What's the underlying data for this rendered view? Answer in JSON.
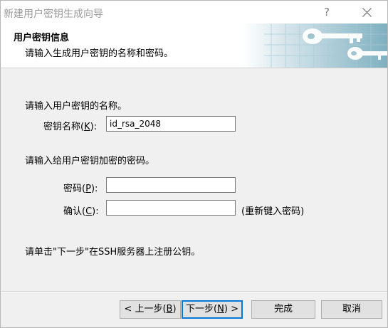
{
  "window": {
    "title": "新建用户密钥生成向导",
    "help_label": "?"
  },
  "header": {
    "title": "用户密钥信息",
    "subtitle": "请输入生成用户密钥的名称和密码。"
  },
  "name_section": {
    "prompt": "请输入用户密钥的名称。",
    "label": "密钥名称",
    "accel": "K",
    "value": "id_rsa_2048"
  },
  "password_section": {
    "prompt": "请输入给用户密钥加密的密码。",
    "password_label": "密码",
    "password_accel": "P",
    "password_value": "",
    "confirm_label": "确认",
    "confirm_accel": "C",
    "confirm_value": "",
    "confirm_hint": "(重新键入密码)"
  },
  "footer_note": "请单击\"下一步\"在SSH服务器上注册公钥。",
  "buttons": {
    "back_label": "< 上一步",
    "back_accel": "B",
    "next_label": "下一步",
    "next_accel": "N",
    "next_suffix": " >",
    "finish_label": "完成",
    "cancel_label": "取消"
  },
  "colors": {
    "accent": "#0078d7",
    "key_art": "#6aa6b8"
  }
}
